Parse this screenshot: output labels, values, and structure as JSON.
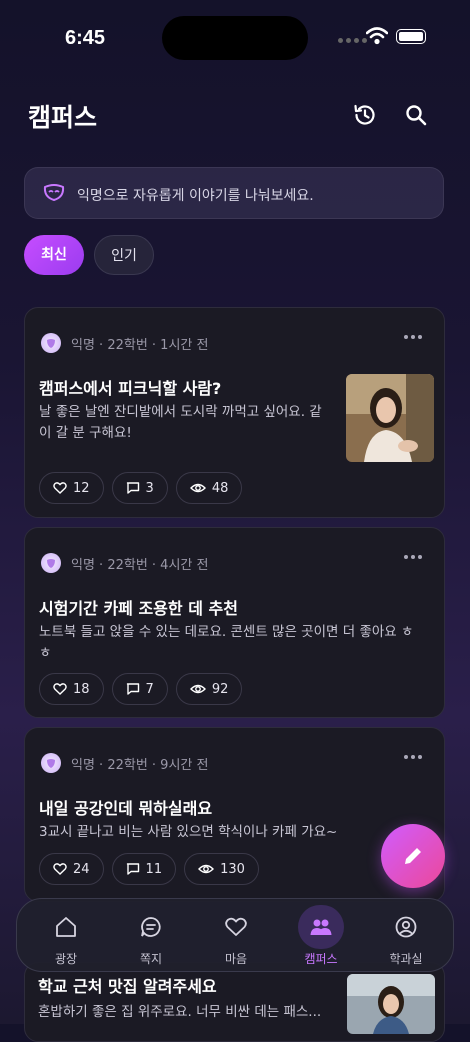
{
  "status": {
    "time": "6:45"
  },
  "header": {
    "title": "캠퍼스",
    "history_icon": "history-icon",
    "search_icon": "search-icon"
  },
  "notice": {
    "text": "익명으로 자유롭게 이야기를 나눠보세요.",
    "icon": "mask-icon"
  },
  "filters": [
    {
      "label": "최신",
      "active": true
    },
    {
      "label": "인기",
      "active": false
    }
  ],
  "posts": [
    {
      "meta": "익명 · 22학번 · 1시간 전",
      "title": "캠퍼스에서 피크닉할 사람?",
      "body_line1": "날 좋은 날엔 잔디밭에서 도시락 까먹고 싶어요. 같",
      "body_line2": "이 갈 분 구해요!",
      "likes": "12",
      "comments": "3",
      "views": "48"
    },
    {
      "meta": "익명 · 22학번 · 4시간 전",
      "title": "시험기간 카페 조용한 데 추천",
      "body_line1": "노트북 들고 앉을 수 있는 데로요. 콘센트 많은 곳이면 더 좋아요 ㅎ",
      "body_line2": "ㅎ",
      "likes": "18",
      "comments": "7",
      "views": "92"
    },
    {
      "meta": "익명 · 22학번 · 9시간 전",
      "title": "내일 공강인데 뭐하실래요",
      "body_line1": "3교시 끝나고 비는 사람 있으면 학식이나 카페 가요~",
      "likes": "24",
      "comments": "11",
      "views": "130"
    },
    {
      "title": "학교 근처 맛집 알려주세요",
      "body_line1": "혼밥하기 좋은 집 위주로요. 너무 비싼 데는 패스..."
    }
  ],
  "tabs": [
    {
      "label": "광장"
    },
    {
      "label": "쪽지"
    },
    {
      "label": "마음"
    },
    {
      "label": "캠퍼스",
      "active": true
    },
    {
      "label": "학과실"
    }
  ],
  "colors": {
    "accent": "#c64dff",
    "fab_end": "#ec4899",
    "card_bg": "#1b1a24"
  }
}
